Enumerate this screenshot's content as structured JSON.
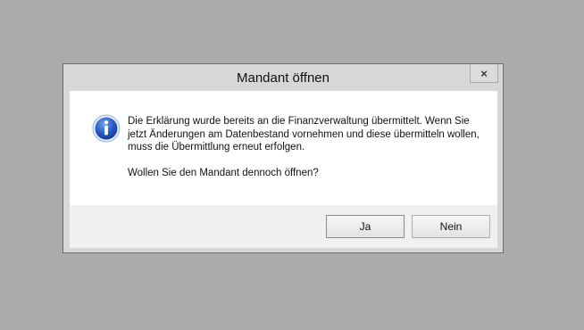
{
  "dialog": {
    "title": "Mandant öffnen",
    "close_label": "×",
    "icon": "info-icon",
    "message": "Die Erklärung wurde bereits an die Finanzverwaltung übermittelt. Wenn Sie jetzt Änderungen am Datenbestand vornehmen und diese übermitteln wollen, muss die Übermittlung erneut erfolgen.",
    "question": "Wollen Sie den Mandant dennoch öffnen?",
    "buttons": {
      "yes_label": "Ja",
      "no_label": "Nein"
    }
  },
  "colors": {
    "desktop_background": "#ababab",
    "dialog_frame": "#d7d7d7",
    "info_icon_blue": "#2457c4"
  }
}
